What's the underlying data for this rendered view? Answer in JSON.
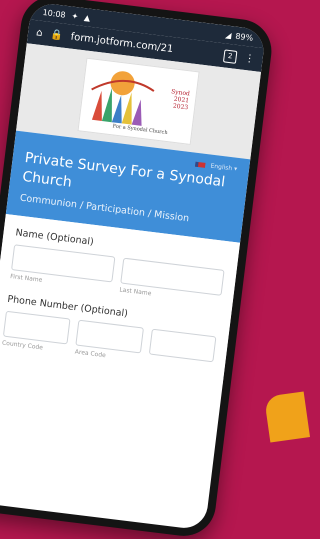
{
  "status": {
    "time": "10:08",
    "battery": "89%"
  },
  "browser": {
    "url": "form.jotform.com/21",
    "tab_count": "2",
    "menu_icon": "more-vert-icon"
  },
  "logo": {
    "caption_line1": "Synod",
    "caption_line2": "2021",
    "caption_line3": "2023",
    "caption_bottom": "For a Synodal Church"
  },
  "form_header": {
    "language": "English",
    "title": "Private Survey For a Synodal Church",
    "subtitle": "Communion / Participation / Mission"
  },
  "fields": {
    "name_label": "Name (Optional)",
    "first_name": "First Name",
    "last_name": "Last Name",
    "phone_label": "Phone Number (Optional)",
    "country_code": "Country Code",
    "area_code": "Area Code"
  },
  "colors": {
    "background": "#b5174f",
    "header_blue": "#3f8ed8",
    "status_bar": "#1e2a3a",
    "accent": "#f0a21a"
  }
}
